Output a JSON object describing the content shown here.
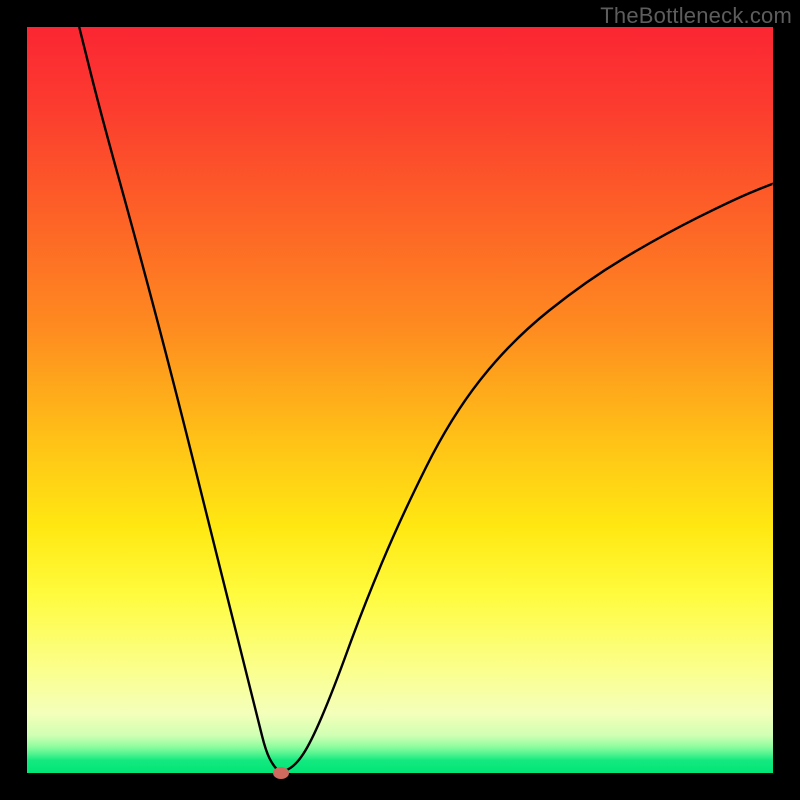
{
  "watermark": "TheBottleneck.com",
  "colors": {
    "frame": "#000000",
    "curve_stroke": "#000000",
    "dot_fill": "#cf6a5e",
    "gradient_top": "#fb2633",
    "gradient_bottom": "#00e676"
  },
  "chart_data": {
    "type": "line",
    "title": "",
    "xlabel": "",
    "ylabel": "",
    "xlim": [
      0,
      100
    ],
    "ylim": [
      0,
      100
    ],
    "grid": false,
    "legend": false,
    "annotations": [],
    "x": [
      7,
      10,
      15,
      20,
      24,
      27,
      29,
      31,
      32,
      33,
      34,
      36,
      38,
      41,
      45,
      50,
      57,
      65,
      75,
      85,
      95,
      100
    ],
    "values": [
      100,
      88,
      70,
      51,
      35,
      23,
      15,
      7,
      3,
      1,
      0,
      1,
      4,
      11,
      22,
      34,
      48,
      58,
      66,
      72,
      77,
      79
    ],
    "minimum_point": {
      "x": 34,
      "y": 0
    },
    "background_zones": [
      {
        "from_pct": 0,
        "to_pct": 3,
        "color": "green"
      },
      {
        "from_pct": 3,
        "to_pct": 12,
        "color": "pale"
      },
      {
        "from_pct": 12,
        "to_pct": 40,
        "color": "yellow"
      },
      {
        "from_pct": 40,
        "to_pct": 70,
        "color": "orange"
      },
      {
        "from_pct": 70,
        "to_pct": 100,
        "color": "red"
      }
    ]
  }
}
